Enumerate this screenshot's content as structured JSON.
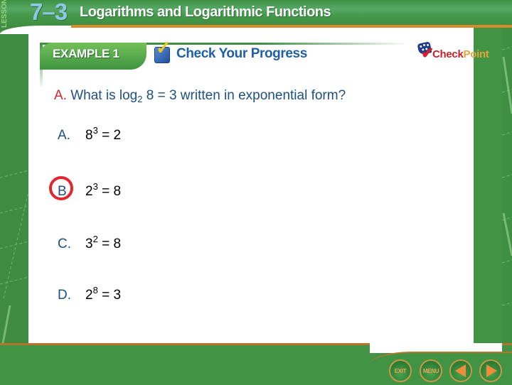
{
  "header": {
    "lesson_label": "LESSON",
    "lesson_number": "7–3",
    "lesson_title": "Logarithms and Logarithmic Functions"
  },
  "example_bar": {
    "example_label": "EXAMPLE 1",
    "check_label": "Check Your Progress",
    "checkpoint_logo": {
      "check": "Check",
      "point": "Point"
    }
  },
  "question": {
    "letter": "A.",
    "text_before": " What is log",
    "subscript": "2",
    "text_after": " 8 = 3 written in exponential form?"
  },
  "answers": [
    {
      "letter": "A.",
      "base": "8",
      "exp": "3",
      "rest": " = 2",
      "selected": false
    },
    {
      "letter": "B.",
      "base": "2",
      "exp": "3",
      "rest": " = 8",
      "selected": true
    },
    {
      "letter": "C.",
      "base": "3",
      "exp": "2",
      "rest": " = 8",
      "selected": false
    },
    {
      "letter": "D.",
      "base": "2",
      "exp": "8",
      "rest": " = 3",
      "selected": false
    }
  ],
  "nav": {
    "exit_label": "EXIT",
    "menu_label": "MENU",
    "prev_icon": "triangle-left",
    "next_icon": "triangle-right"
  },
  "colors": {
    "green": "#429444",
    "orange_rule": "#d98a2b",
    "question_blue": "#1f4f7f",
    "question_red": "#cf2a2e",
    "selection_ring": "#e3262b",
    "check_blue": "#1f5fa6"
  }
}
